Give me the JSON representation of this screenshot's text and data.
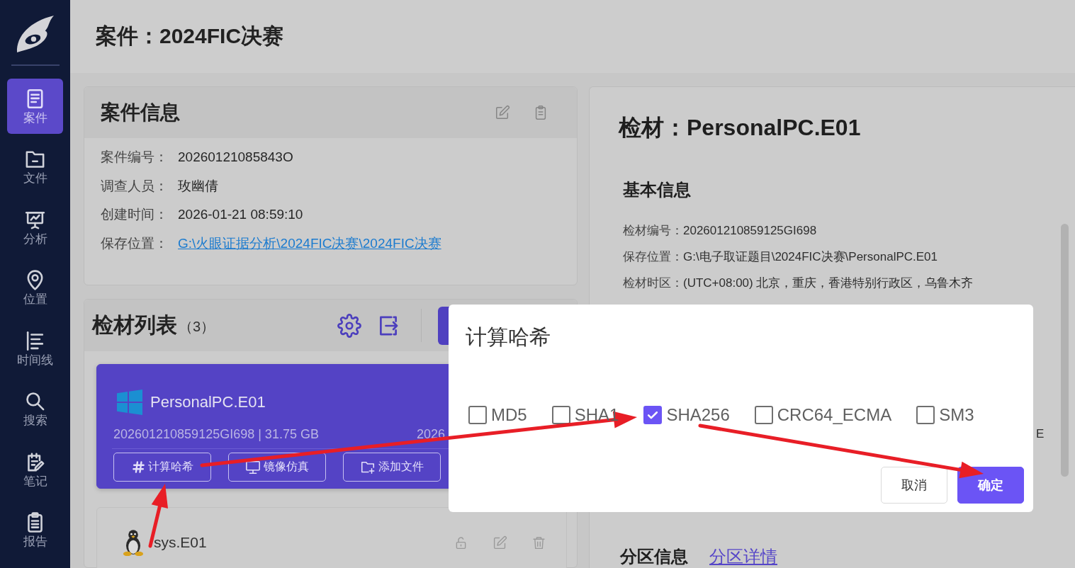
{
  "sidebar": {
    "items": [
      {
        "label": "案件",
        "selected": true
      },
      {
        "label": "文件",
        "selected": false
      },
      {
        "label": "分析",
        "selected": false
      },
      {
        "label": "位置",
        "selected": false
      },
      {
        "label": "时间线",
        "selected": false
      },
      {
        "label": "搜索",
        "selected": false
      },
      {
        "label": "笔记",
        "selected": false
      },
      {
        "label": "报告",
        "selected": false
      }
    ]
  },
  "header": {
    "title": "案件：2024FIC决赛"
  },
  "case_info": {
    "title": "案件信息",
    "fields": [
      {
        "label": "案件编号：",
        "value": "20260121085843O",
        "kind": "text"
      },
      {
        "label": "调查人员：",
        "value": "玫幽倩",
        "kind": "text"
      },
      {
        "label": "创建时间：",
        "value": "2026-01-21 08:59:10",
        "kind": "text"
      },
      {
        "label": "保存位置：",
        "value": "G:\\火眼证据分析\\2024FIC决赛\\2024FIC决赛",
        "kind": "link"
      }
    ]
  },
  "evidence_list": {
    "title": "检材列表",
    "count": "（3）",
    "items": [
      {
        "name": "PersonalPC.E01",
        "selected": true,
        "meta": "202601210859125GI698 | 31.75 GB",
        "meta_2": "2026",
        "actions": [
          "计算哈希",
          "镜像仿真",
          "添加文件"
        ]
      },
      {
        "name": "sys.E01",
        "selected": false
      }
    ]
  },
  "evidence_detail": {
    "title": "检材：PersonalPC.E01",
    "basic_info": {
      "title": "基本信息",
      "fields": [
        {
          "label": "检材编号：",
          "value": "202601210859125GI698"
        },
        {
          "label": "保存位置：",
          "value": "G:\\电子取证题目\\2024FIC决赛\\PersonalPC.E01"
        },
        {
          "label": "检材时区：",
          "value": "(UTC+08:00) 北京，重庆，香港特别行政区，乌鲁木齐"
        }
      ],
      "fragment": "E"
    },
    "partition_info": {
      "title": "分区信息",
      "link": "分区详情"
    }
  },
  "dialog": {
    "title": "计算哈希",
    "options": [
      {
        "label": "MD5",
        "checked": false
      },
      {
        "label": "SHA1",
        "checked": false
      },
      {
        "label": "SHA256",
        "checked": true
      },
      {
        "label": "CRC64_ECMA",
        "checked": false
      },
      {
        "label": "SM3",
        "checked": false
      }
    ],
    "buttons": [
      {
        "label": "取消",
        "kind": "default"
      },
      {
        "label": "确定",
        "kind": "primary"
      }
    ]
  }
}
